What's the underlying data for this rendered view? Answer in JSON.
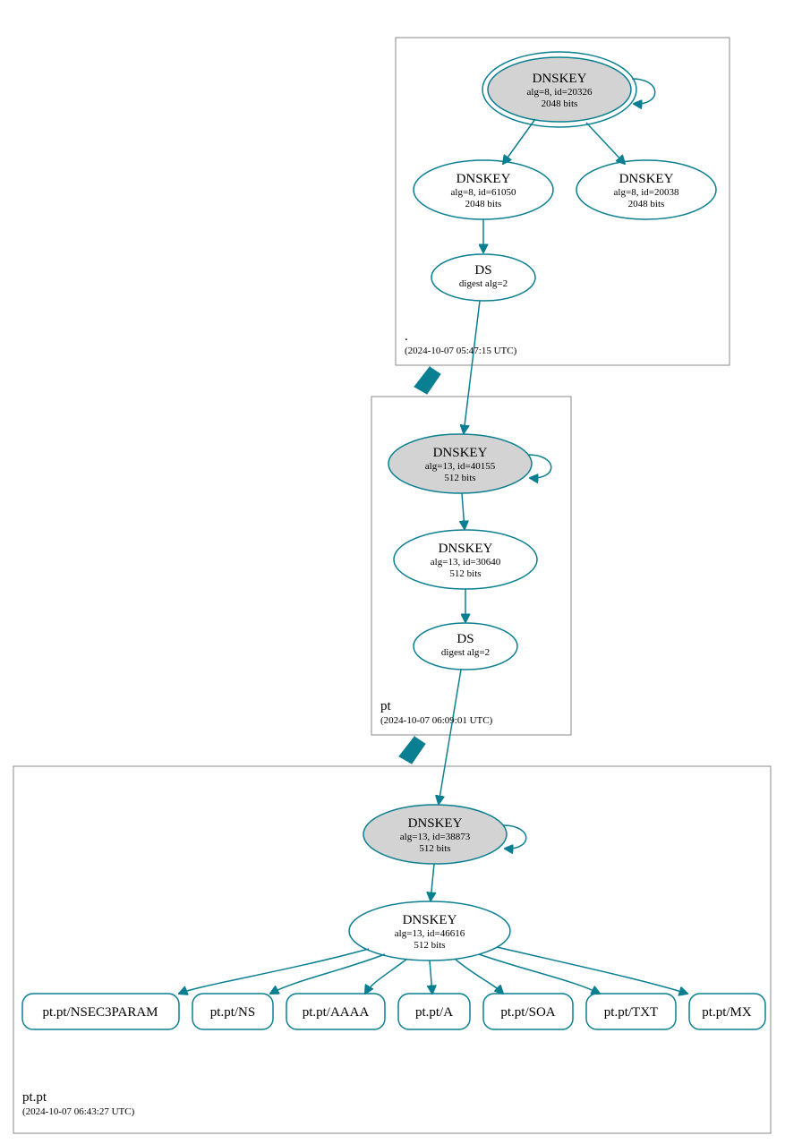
{
  "colors": {
    "accent": "#0a7f91",
    "ksk_fill": "#d3d3d3",
    "box_stroke": "#888888"
  },
  "zones": {
    "root": {
      "name": ".",
      "timestamp": "(2024-10-07 05:47:15 UTC)"
    },
    "pt": {
      "name": "pt",
      "timestamp": "(2024-10-07 06:09:01 UTC)"
    },
    "ptpt": {
      "name": "pt.pt",
      "timestamp": "(2024-10-07 06:43:27 UTC)"
    }
  },
  "nodes": {
    "root_ksk": {
      "title": "DNSKEY",
      "line2": "alg=8, id=20326",
      "line3": "2048 bits"
    },
    "root_zsk": {
      "title": "DNSKEY",
      "line2": "alg=8, id=61050",
      "line3": "2048 bits"
    },
    "root_zsk2": {
      "title": "DNSKEY",
      "line2": "alg=8, id=20038",
      "line3": "2048 bits"
    },
    "root_ds": {
      "title": "DS",
      "line2": "digest alg=2",
      "line3": ""
    },
    "pt_ksk": {
      "title": "DNSKEY",
      "line2": "alg=13, id=40155",
      "line3": "512 bits"
    },
    "pt_zsk": {
      "title": "DNSKEY",
      "line2": "alg=13, id=30640",
      "line3": "512 bits"
    },
    "pt_ds": {
      "title": "DS",
      "line2": "digest alg=2",
      "line3": ""
    },
    "ptpt_ksk": {
      "title": "DNSKEY",
      "line2": "alg=13, id=38873",
      "line3": "512 bits"
    },
    "ptpt_zsk": {
      "title": "DNSKEY",
      "line2": "alg=13, id=46616",
      "line3": "512 bits"
    }
  },
  "rrsets": {
    "nsec3param": "pt.pt/NSEC3PARAM",
    "ns": "pt.pt/NS",
    "aaaa": "pt.pt/AAAA",
    "a": "pt.pt/A",
    "soa": "pt.pt/SOA",
    "txt": "pt.pt/TXT",
    "mx": "pt.pt/MX"
  }
}
